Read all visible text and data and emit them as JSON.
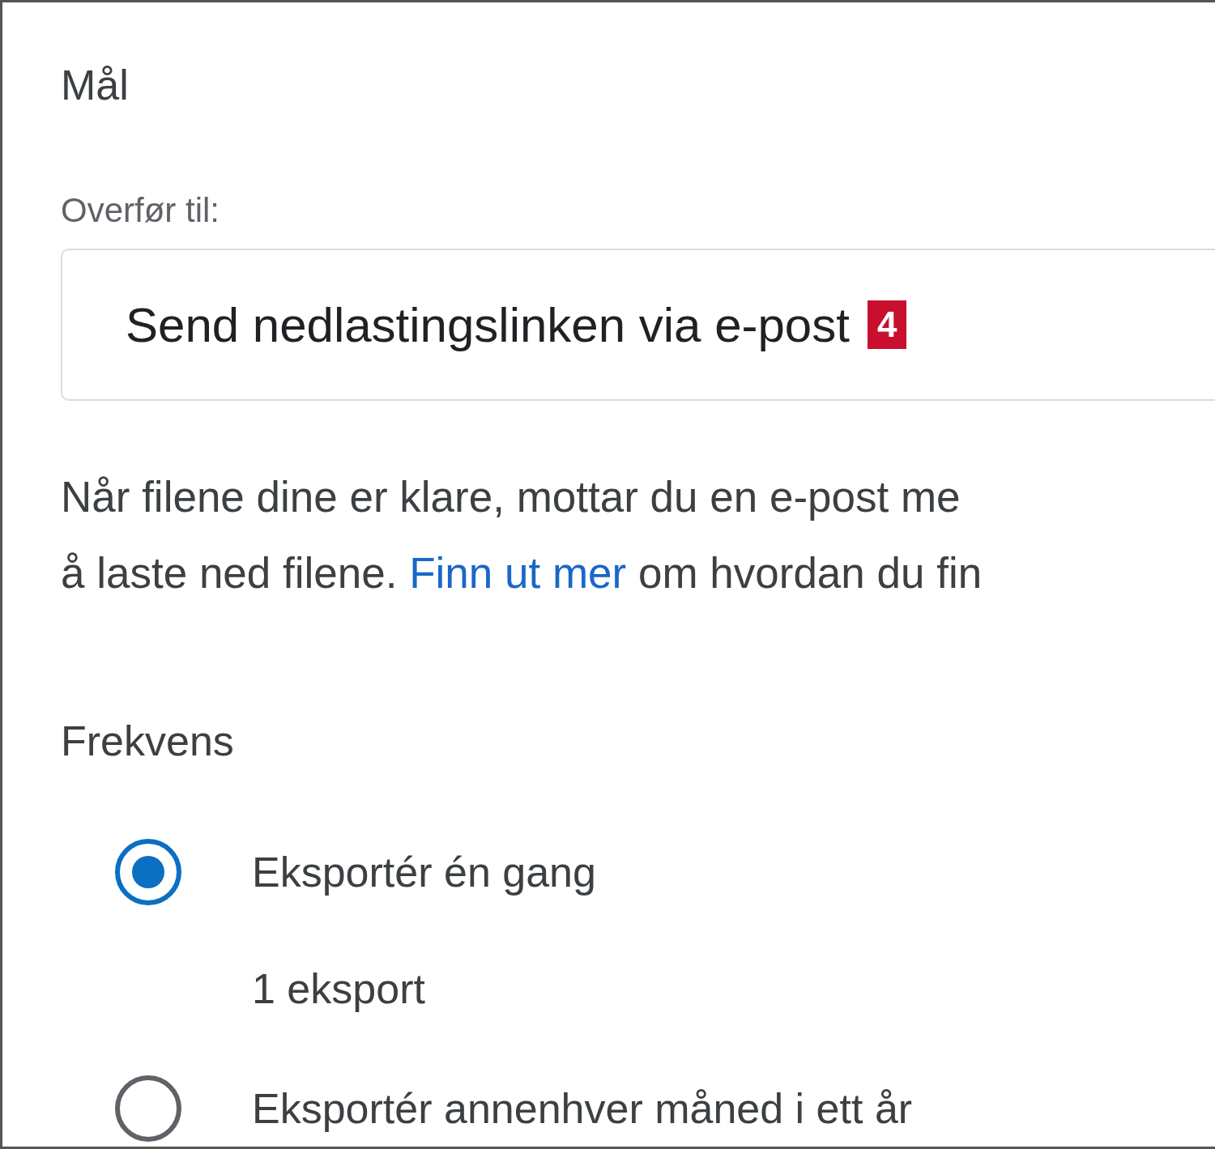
{
  "section_title": "Mål",
  "destination": {
    "label": "Overfør til:",
    "value": "Send nedlastingslinken via e-post",
    "badge": "4"
  },
  "description": {
    "line_1": "Når filene dine er klare, mottar du en e-post me",
    "line_2_before": "å laste ned filene. ",
    "link": "Finn ut mer",
    "line_2_after": " om hvordan du fin"
  },
  "frequency": {
    "title": "Frekvens",
    "options": [
      {
        "label": "Eksportér én gang",
        "detail": "1 eksport",
        "selected": true
      },
      {
        "label": "Eksportér annenhver måned i ett år",
        "selected": false
      }
    ]
  }
}
